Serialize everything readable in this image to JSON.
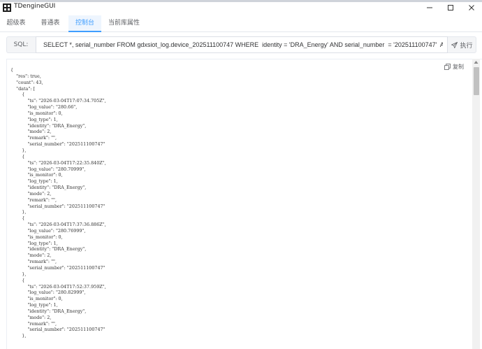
{
  "window": {
    "title": "TDengineGUI",
    "background_text": "...",
    "controls": {
      "minimize": "minimize",
      "maximize": "maximize",
      "close": "close"
    }
  },
  "tabs": [
    {
      "label": "超级表",
      "active": false
    },
    {
      "label": "普通表",
      "active": false
    },
    {
      "label": "控制台",
      "active": true
    },
    {
      "label": "当前库属性",
      "active": false
    }
  ],
  "sql": {
    "label": "SQL:",
    "query": "SELECT *, serial_number FROM gdxsiot_log.device_202511100747 WHERE  identity = 'DRA_Energy' AND serial_number  = '202511100747'  AND  ts BETWEEN",
    "run_label": "执行"
  },
  "result": {
    "copy_label": "复制",
    "json_text": "{\n    \"res\": true,\n    \"count\": 43,\n    \"data\": [\n        {\n            \"ts\": \"2026-03-04T17:07:34.705Z\",\n            \"log_value\": \"280.66\",\n            \"is_monitor\": 0,\n            \"log_type\": 1,\n            \"identity\": \"DRA_Energy\",\n            \"mode\": 2,\n            \"remark\": \"\",\n            \"serial_number\": \"202511100747\"\n        },\n        {\n            \"ts\": \"2026-03-04T17:22:35.840Z\",\n            \"log_value\": \"280.70999\",\n            \"is_monitor\": 0,\n            \"log_type\": 1,\n            \"identity\": \"DRA_Energy\",\n            \"mode\": 2,\n            \"remark\": \"\",\n            \"serial_number\": \"202511100747\"\n        },\n        {\n            \"ts\": \"2026-03-04T17:37:36.886Z\",\n            \"log_value\": \"280.76999\",\n            \"is_monitor\": 0,\n            \"log_type\": 1,\n            \"identity\": \"DRA_Energy\",\n            \"mode\": 2,\n            \"remark\": \"\",\n            \"serial_number\": \"202511100747\"\n        },\n        {\n            \"ts\": \"2026-03-04T17:52:37.959Z\",\n            \"log_value\": \"280.82999\",\n            \"is_monitor\": 0,\n            \"log_type\": 1,\n            \"identity\": \"DRA_Energy\",\n            \"mode\": 2,\n            \"remark\": \"\",\n            \"serial_number\": \"202511100747\"\n        },"
  },
  "colors": {
    "accent": "#409eff",
    "active_tab_bg": "#eef5fe",
    "bar_bg": "#f4f5f7",
    "text": "#303133"
  },
  "icons": {
    "app": "tdengine-app-icon",
    "run": "send-icon",
    "copy": "copy-icon"
  }
}
